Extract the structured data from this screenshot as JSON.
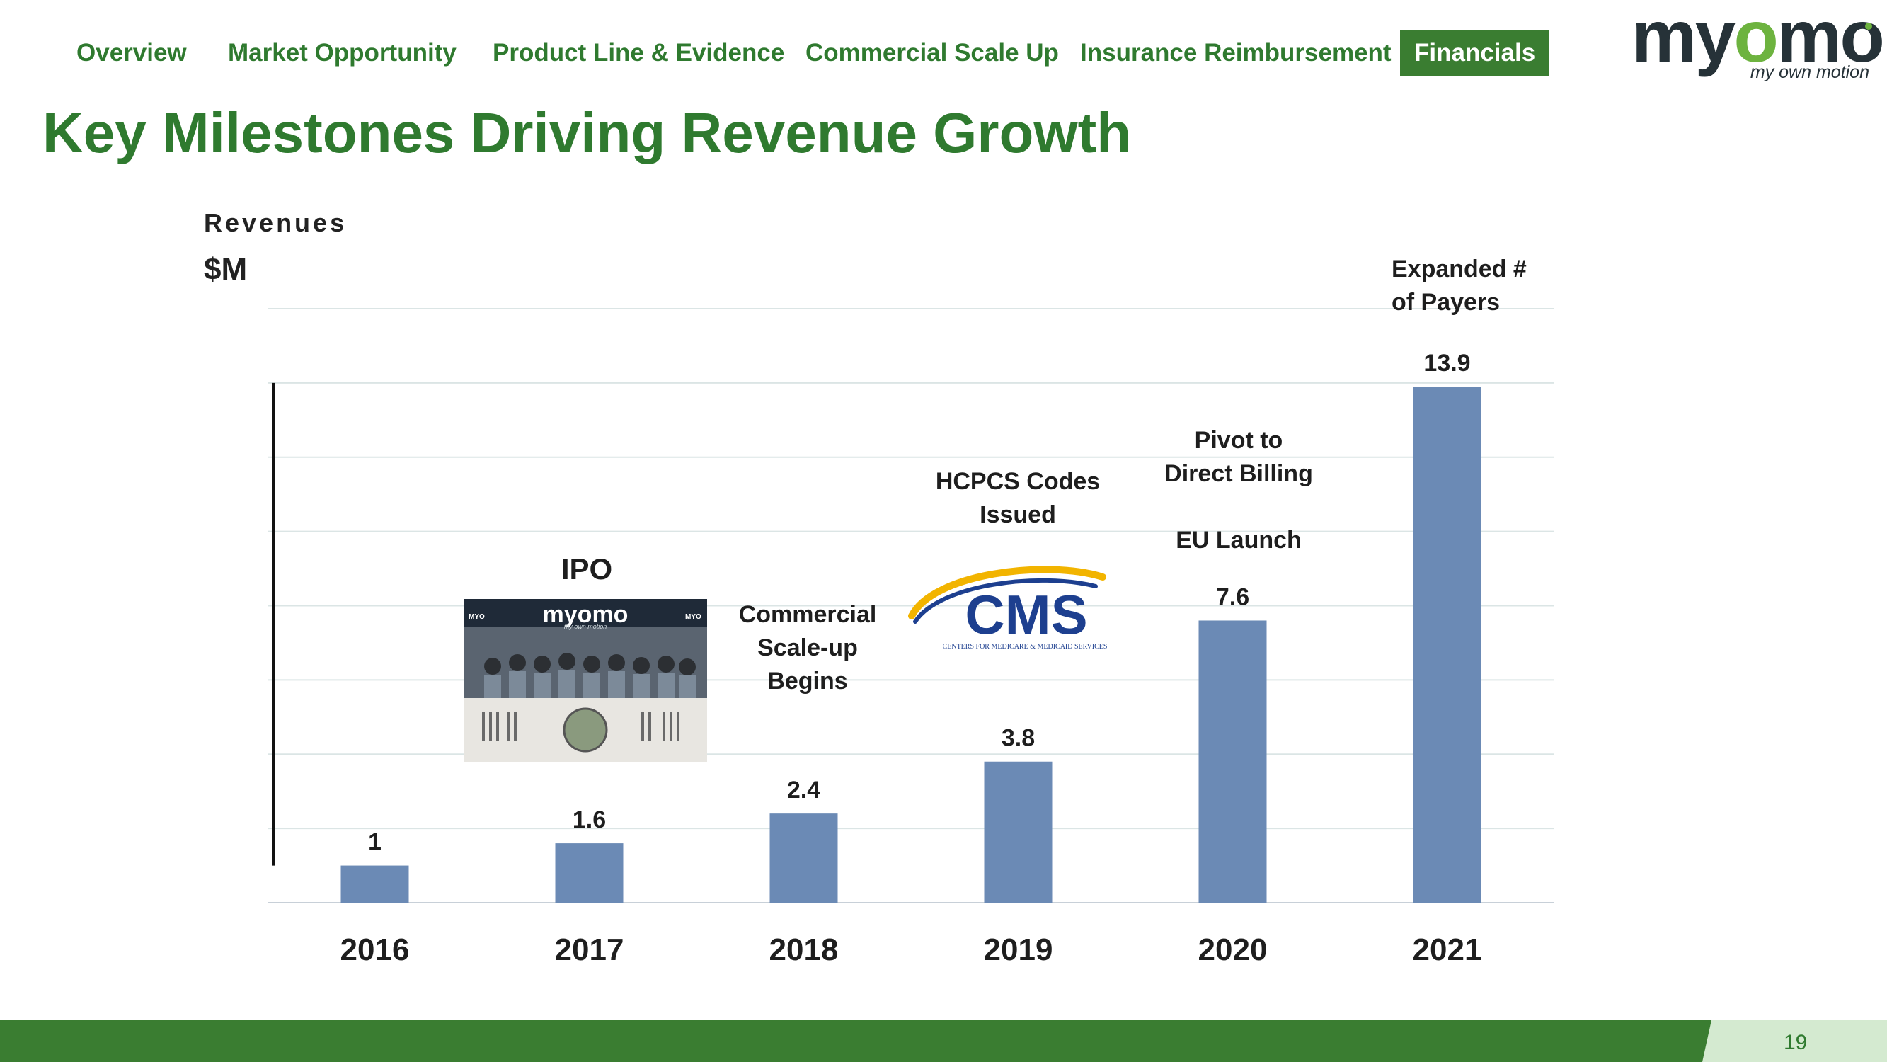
{
  "nav": {
    "items": [
      {
        "label": "Overview"
      },
      {
        "label": "Market Opportunity"
      },
      {
        "label": "Product Line & Evidence"
      },
      {
        "label": "Commercial Scale Up"
      },
      {
        "label": "Insurance Reimbursement"
      },
      {
        "label": "Financials"
      }
    ],
    "active": "Financials"
  },
  "logo": {
    "word_a": "my",
    "word_o": "o",
    "word_b": "mo",
    "tagline": "my own motion"
  },
  "page": {
    "title": "Key Milestones Driving Revenue Growth",
    "page_number": "19"
  },
  "unit_label": {
    "line1": "Revenues",
    "line2": "$M"
  },
  "annotations": {
    "ipo": "IPO",
    "commercial": [
      "Commercial",
      "Scale-up",
      "Begins"
    ],
    "hcpcs": [
      "HCPCS Codes",
      "Issued"
    ],
    "pivot": [
      "Pivot to",
      "Direct Billing"
    ],
    "eu": "EU Launch",
    "payers": [
      "Expanded #",
      "of Payers"
    ]
  },
  "images": {
    "ipo_photo": {
      "banner_text": "myomo",
      "banner_sub": "my own motion",
      "side_text": "MYO"
    },
    "cms_logo": {
      "mark": "CMS",
      "subtitle": "CENTERS FOR MEDICARE & MEDICAID SERVICES"
    }
  },
  "colors": {
    "green": "#3a7d31",
    "title_green": "#2f7a2f",
    "bar": "#6b8ab5",
    "light_green": "#d4ead0"
  },
  "chart_data": {
    "type": "bar",
    "categories": [
      "2016",
      "2017",
      "2018",
      "2019",
      "2020",
      "2021"
    ],
    "values": [
      1,
      1.6,
      2.4,
      3.8,
      7.6,
      13.9
    ],
    "data_labels": [
      "1",
      "1.6",
      "2.4",
      "3.8",
      "7.6",
      "13.9"
    ],
    "ylabel": "Revenues $M",
    "ylim": [
      0,
      16
    ],
    "grid": true,
    "legend": "none"
  }
}
